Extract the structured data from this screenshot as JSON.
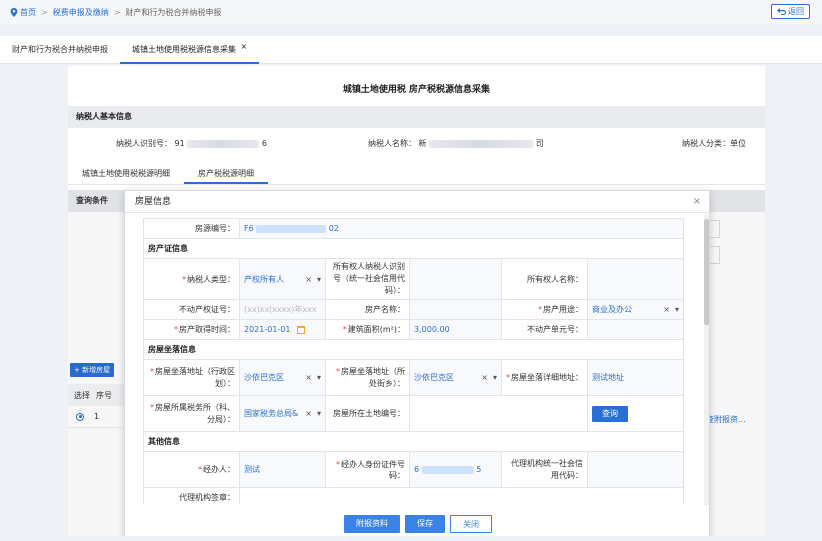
{
  "breadcrumb": {
    "home": "首页",
    "level1": "税费申报及缴纳",
    "level2": "财产和行为税合并纳税申报",
    "back_label": "返回"
  },
  "tabs": [
    {
      "label": "财产和行为税合并纳税申报"
    },
    {
      "label": "城镇土地使用税税源信息采集",
      "close": "×"
    }
  ],
  "page": {
    "title": "城镇土地使用税 房产税税源信息采集",
    "basic_section": "纳税人基本信息",
    "taxpayer_id_label": "纳税人识别号：",
    "taxpayer_id_prefix": "91",
    "taxpayer_id_suffix": "6",
    "taxpayer_name_label": "纳税人名称：",
    "taxpayer_name_prefix": "新",
    "taxpayer_name_suffix": "司",
    "taxpayer_type": "纳税人分类：单位",
    "subtabs": [
      "城镇土地使用税税源明细",
      "房产税税源明细"
    ],
    "query_section": "查询条件",
    "add_button": "+ 新增房屋",
    "table_headers": [
      "选择",
      "序号"
    ],
    "row_index": "1",
    "row_link": "查附报资..."
  },
  "dialog": {
    "title": "房屋信息",
    "close": "×",
    "source_no_label": "房源编号：",
    "source_no_prefix": "F6",
    "source_no_suffix": "02",
    "cert_group": "房产证信息",
    "taxpayer_type_label": "纳税人类型：",
    "taxpayer_type_value": "产权所有人",
    "owner_id_label": "所有权人纳税人识别号（统一社会信用代码）：",
    "owner_name_label": "所有权人名称：",
    "realty_cert_label": "不动产权证号：",
    "realty_cert_placeholder": "(xx)xx(xxxx)年xxx",
    "house_name_label": "房产名称：",
    "house_use_label": "房产用途：",
    "house_use_value": "商业及办公",
    "acquire_date_label": "房产取得时间：",
    "acquire_date_value": "2021-01-01",
    "area_label": "建筑面积(m²)：",
    "area_value": "3,000.00",
    "unit_no_label": "不动产单元号：",
    "location_group": "房屋坐落信息",
    "district_label": "房屋坐落地址（行政区划）：",
    "district_value": "沙依巴克区",
    "street_label": "房屋坐落地址（所处街乡）：",
    "street_value": "沙依巴克区",
    "detail_addr_label": "房屋坐落详细地址：",
    "detail_addr_value": "测试地址",
    "tax_office_label": "房屋所属税务所（科、分局）：",
    "tax_office_value": "国家税务总局&",
    "land_no_label": "房屋所在土地编号：",
    "query_button": "查询",
    "other_group": "其他信息",
    "handler_label": "经办人：",
    "handler_value": "测试",
    "handler_id_label": "经办人身份证件号码：",
    "handler_id_prefix": "6",
    "handler_id_suffix": "5",
    "agency_credit_label": "代理机构统一社会信用代码：",
    "agency_sign_label": "代理机构签章：",
    "footer_buttons": [
      "附报资料",
      "保存",
      "关闭"
    ]
  },
  "colors": {
    "accent": "#2a6fd6",
    "required": "#e34a4a",
    "section_bg": "#e9ebef"
  }
}
